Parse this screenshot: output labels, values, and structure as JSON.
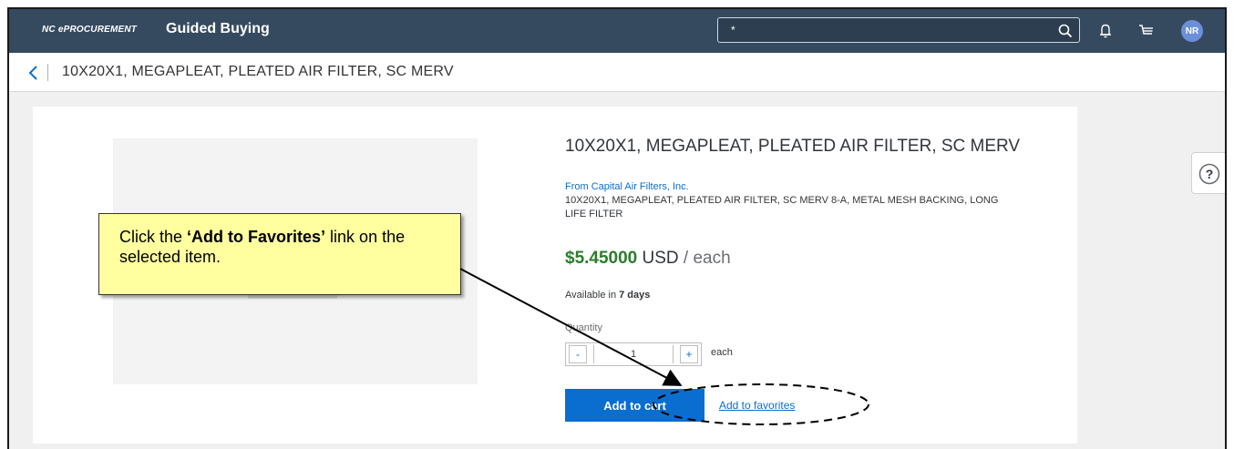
{
  "topbar": {
    "brand_small": "NC ePROCUREMENT",
    "brand_main": "Guided Buying",
    "search_value": "*",
    "avatar_initials": "NR"
  },
  "subheader": {
    "title": "10X20X1, MEGAPLEAT, PLEATED AIR FILTER, SC MERV"
  },
  "product": {
    "title": "10X20X1, MEGAPLEAT, PLEATED AIR FILTER, SC MERV",
    "supplier": "From Capital Air Filters, Inc.",
    "description": "10X20X1, MEGAPLEAT, PLEATED AIR FILTER, SC MERV 8-A, METAL MESH BACKING, LONG LIFE FILTER",
    "price_amount": "$5.45000",
    "price_currency": " USD",
    "price_unit": " / each",
    "availability_prefix": "Available in ",
    "availability_days": "7 days",
    "quantity_label": "Quantity",
    "quantity_value": "1",
    "minus_label": "-",
    "plus_label": "+",
    "quantity_unit": "each",
    "add_to_cart_label": "Add to cart",
    "add_to_favorites_label": "Add to favorites"
  },
  "help": {
    "label": "?"
  },
  "callout": {
    "prefix": "Click the ",
    "highlight": "‘Add to Favorites’",
    "suffix": " link on the selected item."
  },
  "colors": {
    "topbar_bg": "#354a5f",
    "accent_blue": "#0a6ed1",
    "price_green": "#2b7d2b",
    "callout_bg": "#ffffa0"
  },
  "icons": [
    "search-icon",
    "bell-icon",
    "cart-icon",
    "back-chevron-icon",
    "help-icon"
  ]
}
